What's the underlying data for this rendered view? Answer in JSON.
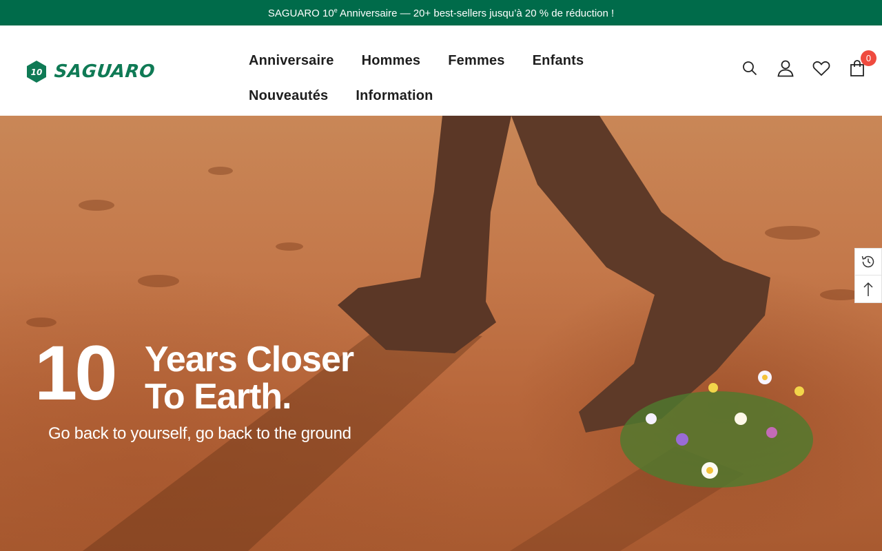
{
  "announcement": {
    "before": "SAGUARO 10",
    "sup": "e",
    "after": " Anniversaire — 20+ best-sellers jusqu’à 20 % de réduction !"
  },
  "brand": {
    "name": "SAGUARO",
    "badge": "10",
    "color": "#0f7a55"
  },
  "nav": {
    "row1": [
      "Anniversaire",
      "Hommes",
      "Femmes",
      "Enfants"
    ],
    "row2": [
      "Nouveautés",
      "Information"
    ]
  },
  "header_icons": [
    "search-icon",
    "account-icon",
    "wishlist-icon",
    "cart-icon"
  ],
  "cart": {
    "count": "0"
  },
  "hero": {
    "big": "10",
    "line1": "Years Closer",
    "line2": "To Earth.",
    "sub": "Go back to yourself, go back to the ground"
  },
  "side_tools": [
    "recently-viewed-icon",
    "back-to-top-icon"
  ],
  "colors": {
    "announcement_bg": "#006b4a",
    "badge": "#ef4b3f"
  }
}
